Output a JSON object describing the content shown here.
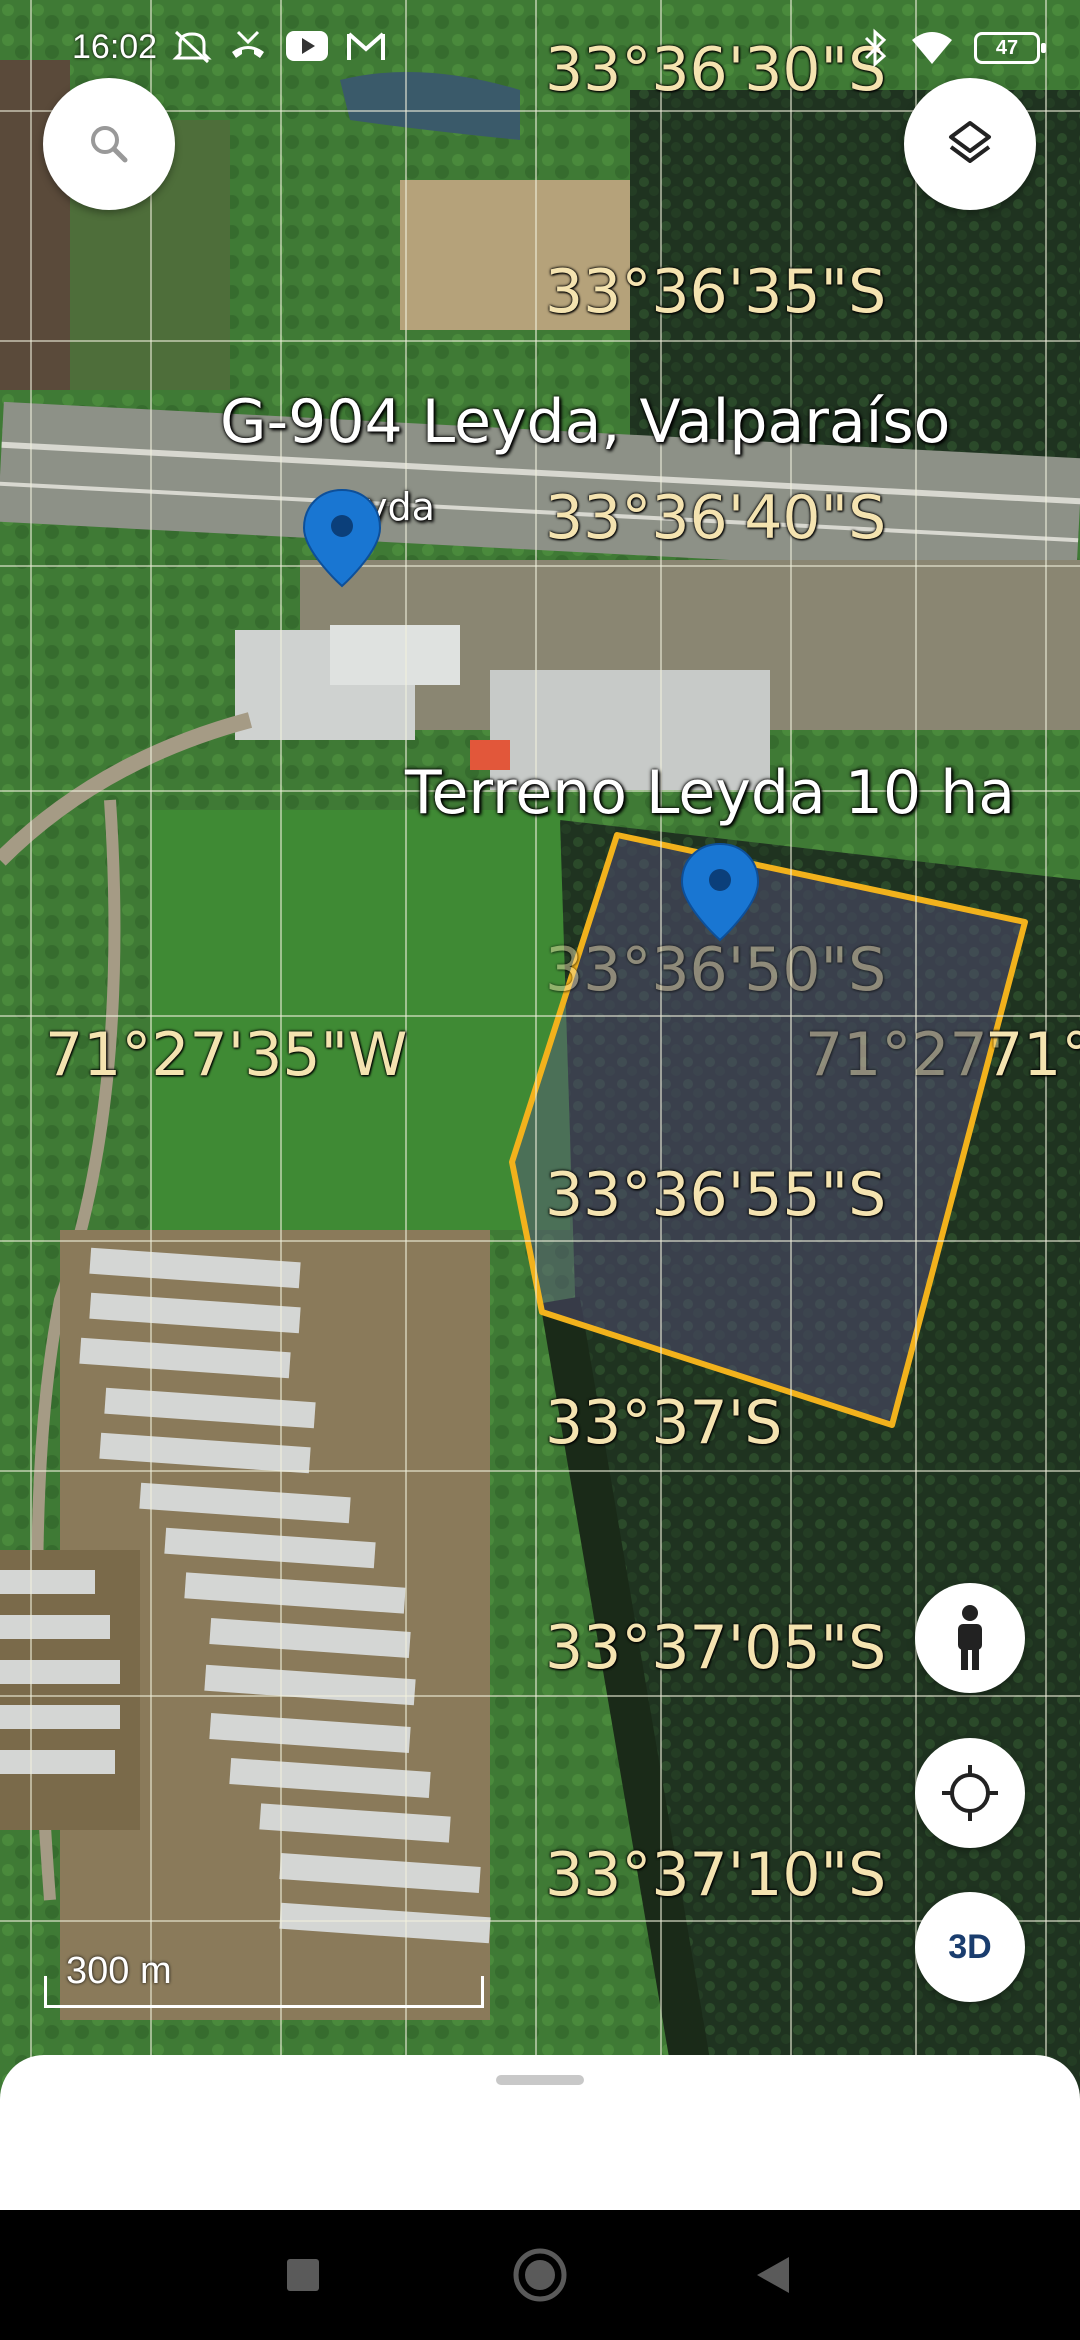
{
  "status_bar": {
    "time": "16:02",
    "battery": "47"
  },
  "map": {
    "latitude_labels": [
      "33°36'30\"S",
      "33°36'35\"S",
      "33°36'40\"S",
      "33°36'50\"S",
      "33°36'55\"S",
      "33°37'S",
      "33°37'05\"S",
      "33°37'10\"S"
    ],
    "longitude_labels": [
      "71°27'35\"W",
      "71°27'",
      "71°"
    ],
    "places": {
      "road_label": "G-904 Leyda, Valparaíso",
      "poi_label": "yda",
      "parcel_label": "Terreno Leyda 10 ha"
    },
    "parcel_outline_color": "#f2b21c",
    "pin_color": "#1976d2",
    "scale_label": "300 m"
  },
  "controls": {
    "search_icon": "search-icon",
    "layers_icon": "layers-icon",
    "street_view_icon": "pegman-icon",
    "my_location_icon": "crosshair-icon",
    "view_3d_label": "3D"
  },
  "nav": {
    "recents_icon": "square-icon",
    "home_icon": "circle-icon",
    "back_icon": "triangle-back-icon"
  }
}
